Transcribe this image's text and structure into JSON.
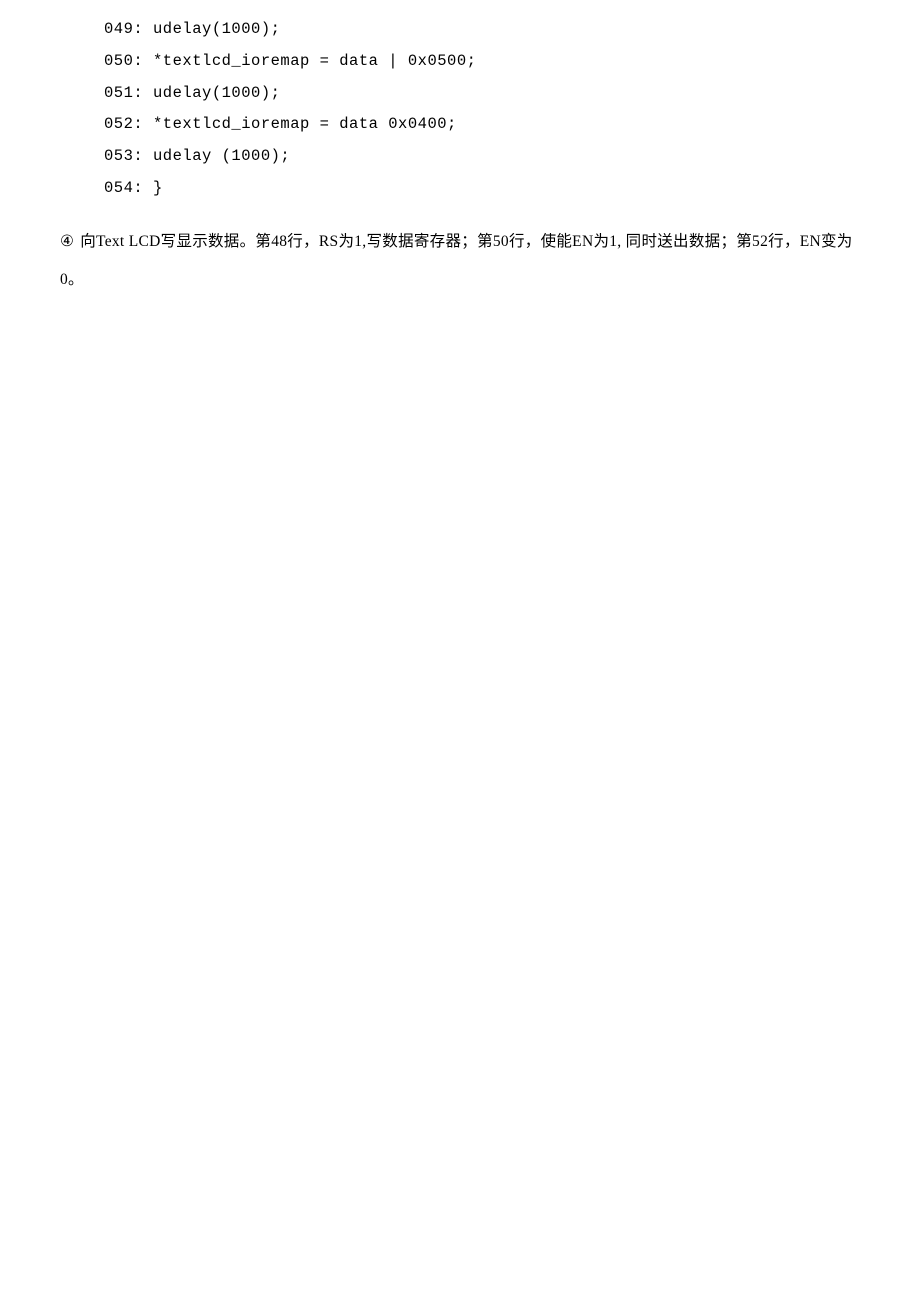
{
  "code": {
    "lines": [
      "049: udelay(1000);",
      "050: *textlcd_ioremap = data | 0x0500;",
      "051: udelay(1000);",
      "052: *textlcd_ioremap = data 0x0400;",
      "053: udelay (1000);",
      "054: }"
    ]
  },
  "explanation": {
    "marker": "④",
    "text": "向Text LCD写显示数据。第48行，RS为1,写数据寄存器；第50行，使能EN为1, 同时送出数据；第52行，EN变为0。"
  }
}
